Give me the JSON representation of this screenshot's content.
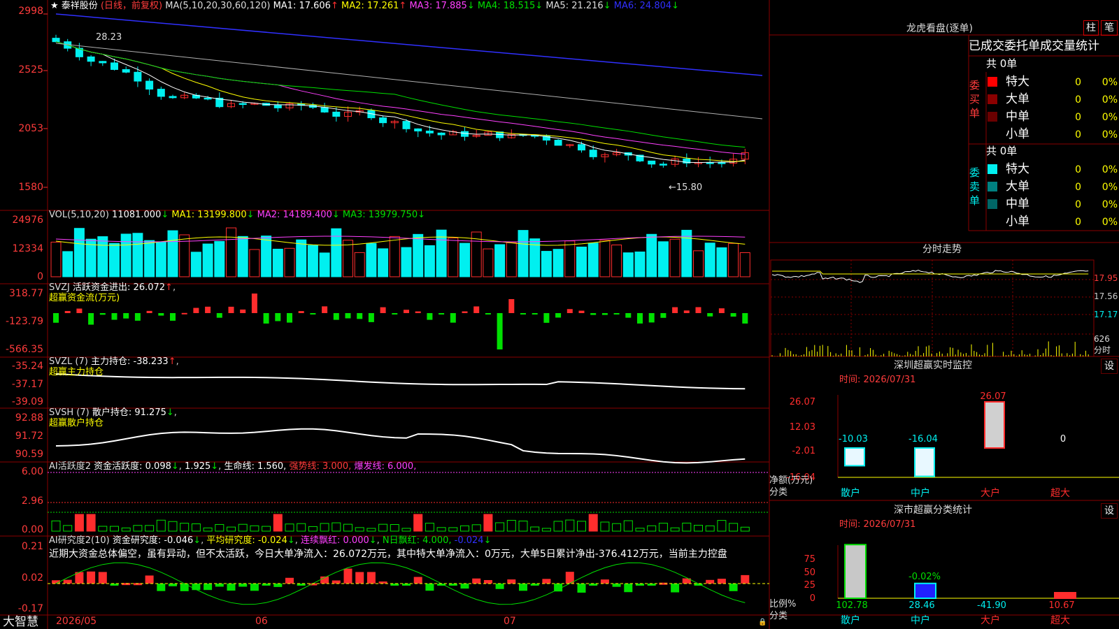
{
  "colors": {
    "up": "#ff2d2d",
    "down": "#00f0f0",
    "grid": "#8a0000",
    "white": "#ffffff",
    "yellow": "#ffff00",
    "magenta": "#ff40ff",
    "green": "#00e000",
    "blue": "#3030ff",
    "gray": "#b0b0b0"
  },
  "header": {
    "star": "★",
    "name": "泰祥股份",
    "mode": "(日线，前复权)",
    "ma_spec": "MA(5,10,20,30,60,120)",
    "ma": [
      {
        "label": "MA1: 17.606",
        "arrow": "↑"
      },
      {
        "label": "MA2: 17.261",
        "arrow": "↑"
      },
      {
        "label": "MA3: 17.885",
        "arrow": "↓"
      },
      {
        "label": "MA4: 18.515",
        "arrow": "↓"
      },
      {
        "label": "MA5: 21.216",
        "arrow": "↓"
      },
      {
        "label": "MA6: 24.804",
        "arrow": "↓"
      }
    ]
  },
  "price_axis": [
    "2998",
    "2525",
    "2053",
    "1580"
  ],
  "price_marks": {
    "high": "28.23",
    "low": "15.80"
  },
  "vol": {
    "title": "VOL(5,10,20)",
    "value": "11081.000",
    "arrow": "↓",
    "ma1": "MA1: 13199.800",
    "ma2": "MA2: 14189.400",
    "ma3": "MA3: 13979.750",
    "axis": [
      "24976",
      "12334",
      "0"
    ]
  },
  "svzj": {
    "title": "SVZJ",
    "label": "活跃资金进出: 26.072",
    "arrow": "↑",
    "sub": "超赢资金流(万元)",
    "axis": [
      "318.77",
      "-123.79",
      "-566.35"
    ]
  },
  "svzl": {
    "title": "SVZL (7)",
    "label": "主力持仓: -38.233",
    "arrow": "↑",
    "sub": "超赢主力持仓",
    "axis": [
      "-35.24",
      "-37.17",
      "-39.09"
    ]
  },
  "svsh": {
    "title": "SVSH (7)",
    "label": "散户持仓: 91.275",
    "arrow": "↓",
    "sub": "超赢散户持仓",
    "axis": [
      "92.88",
      "91.72",
      "90.59"
    ]
  },
  "ai1": {
    "title": "AI活跃度2",
    "label": "资金活跃度: 0.098",
    "v2": "1.925",
    "v3": "生命线: 1.560,",
    "v4": "强势线: 3.000,",
    "v5": "爆发线: 6.000,",
    "axis": [
      "6.00",
      "2.96",
      "0.00"
    ]
  },
  "ai2": {
    "title": "AI研究度2(10)",
    "label": "资金研究度: -0.046",
    "v2": "平均研究度: -0.024",
    "v3": "连续飘红: 0.000",
    "v4": "N日飘红: 4.000,",
    "v5": "-0.024",
    "axis": [
      "0.21",
      "0.02",
      "-0.17"
    ],
    "comment": "近期大资金总体偏空，虽有异动，但不太活跃，今日大单净流入：26.072万元，其中特大单净流入：0万元，大单5日累计净出-376.412万元，当前主力控盘"
  },
  "dates": [
    "2026/05",
    "06",
    "07"
  ],
  "logo": "大智慧",
  "right": {
    "title": "龙虎看盘(逐单)",
    "btn1": "柱",
    "btn2": "笔",
    "stats_title": "已成交委托单成交量统计",
    "buy": {
      "total": "共 0单",
      "side": "委买单",
      "rows": [
        {
          "n": "特大",
          "v": "0",
          "p": "0%"
        },
        {
          "n": "大单",
          "v": "0",
          "p": "0%"
        },
        {
          "n": "中单",
          "v": "0",
          "p": "0%"
        },
        {
          "n": "小单",
          "v": "0",
          "p": "0%"
        }
      ]
    },
    "sell": {
      "total": "共 0单",
      "side": "委卖单",
      "rows": [
        {
          "n": "特大",
          "v": "0",
          "p": "0%"
        },
        {
          "n": "大单",
          "v": "0",
          "p": "0%"
        },
        {
          "n": "中单",
          "v": "0",
          "p": "0%"
        },
        {
          "n": "小单",
          "v": "0",
          "p": "0%"
        }
      ]
    },
    "intraday": {
      "title": "分时走势",
      "axis": [
        "17.95",
        "17.56",
        "17.17"
      ],
      "vol": "626",
      "vol_unit": "分时"
    },
    "monitor": {
      "title": "深圳超赢实时监控",
      "set": "设",
      "time": "时间: 2026/07/31",
      "axis": [
        "26.07",
        "12.03",
        "-2.01",
        "-16.04"
      ],
      "unit": "净额(万元)",
      "cat_label": "分类",
      "cats": [
        "散户",
        "中户",
        "大户",
        "超大"
      ],
      "values": [
        "-10.03",
        "-16.04",
        "26.07",
        "0"
      ]
    },
    "stats": {
      "title": "深市超赢分类统计",
      "set": "设",
      "time": "时间: 2026/07/31",
      "axis": [
        "75",
        "50",
        "25",
        "0"
      ],
      "unit": "比例%",
      "cat_label": "分类",
      "cats": [
        "散户",
        "中户",
        "大户",
        "超大"
      ],
      "values": [
        "102.78",
        "28.46",
        "-41.90",
        "10.67"
      ],
      "extra": "-0.02%"
    }
  }
}
